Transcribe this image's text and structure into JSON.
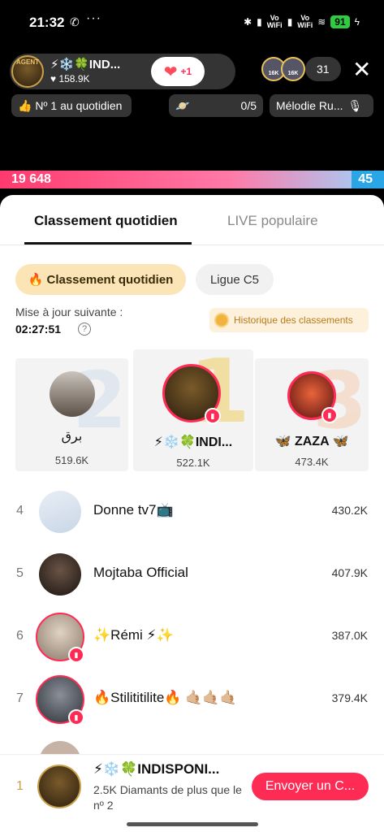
{
  "status": {
    "time": "21:32",
    "battery": "91",
    "sig1": "Vo\nWiFi",
    "sig2": "Vo\nWiFi"
  },
  "live": {
    "host_name": "⚡❄️🍀IND...",
    "host_likes": "♥ 158.9K",
    "like_label": "+1",
    "viewer_count": "31",
    "viewer_badge_1": "16K",
    "viewer_badge_2": "16K",
    "chip_rank": "👍 Nº 1 au quotidien",
    "chip_progress": "0/5",
    "chip_song": "Mélodie Ru..."
  },
  "progress": {
    "left": "19 648",
    "right": "45"
  },
  "sheet": {
    "tabs": [
      {
        "label": "Classement quotidien",
        "active": true
      },
      {
        "label": "LIVE populaire",
        "active": false
      }
    ],
    "pills": [
      "🔥 Classement quotidien",
      "Ligue C5"
    ],
    "update_label": "Mise à jour suivante :",
    "update_time": "02:27:51",
    "history_label": "Historique des classements"
  },
  "podium": [
    {
      "rank": "2",
      "name": "برق",
      "score": "519.6K"
    },
    {
      "rank": "1",
      "name": "⚡❄️🍀INDI...",
      "score": "522.1K"
    },
    {
      "rank": "3",
      "name": "🦋 ZAZA 🦋",
      "score": "473.4K"
    }
  ],
  "list": [
    {
      "rank": "4",
      "name": "Donne tv7📺",
      "score": "430.2K"
    },
    {
      "rank": "5",
      "name": "Mojtaba Official",
      "score": "407.9K"
    },
    {
      "rank": "6",
      "name": "✨Rémi ⚡✨",
      "score": "387.0K"
    },
    {
      "rank": "7",
      "name": "🔥Stilititilite🔥 🤙🏼🤙🏼🤙🏼",
      "score": "379.4K"
    }
  ],
  "bottom": {
    "rank": "1",
    "name": "⚡❄️🍀INDISPONI...",
    "sub": "2.5K Diamants de plus que le nº 2",
    "button": "Envoyer un C..."
  },
  "colors": {
    "accent": "#fe2c55",
    "gold": "#c9a14a",
    "pill_active": "#fbe5b6"
  }
}
